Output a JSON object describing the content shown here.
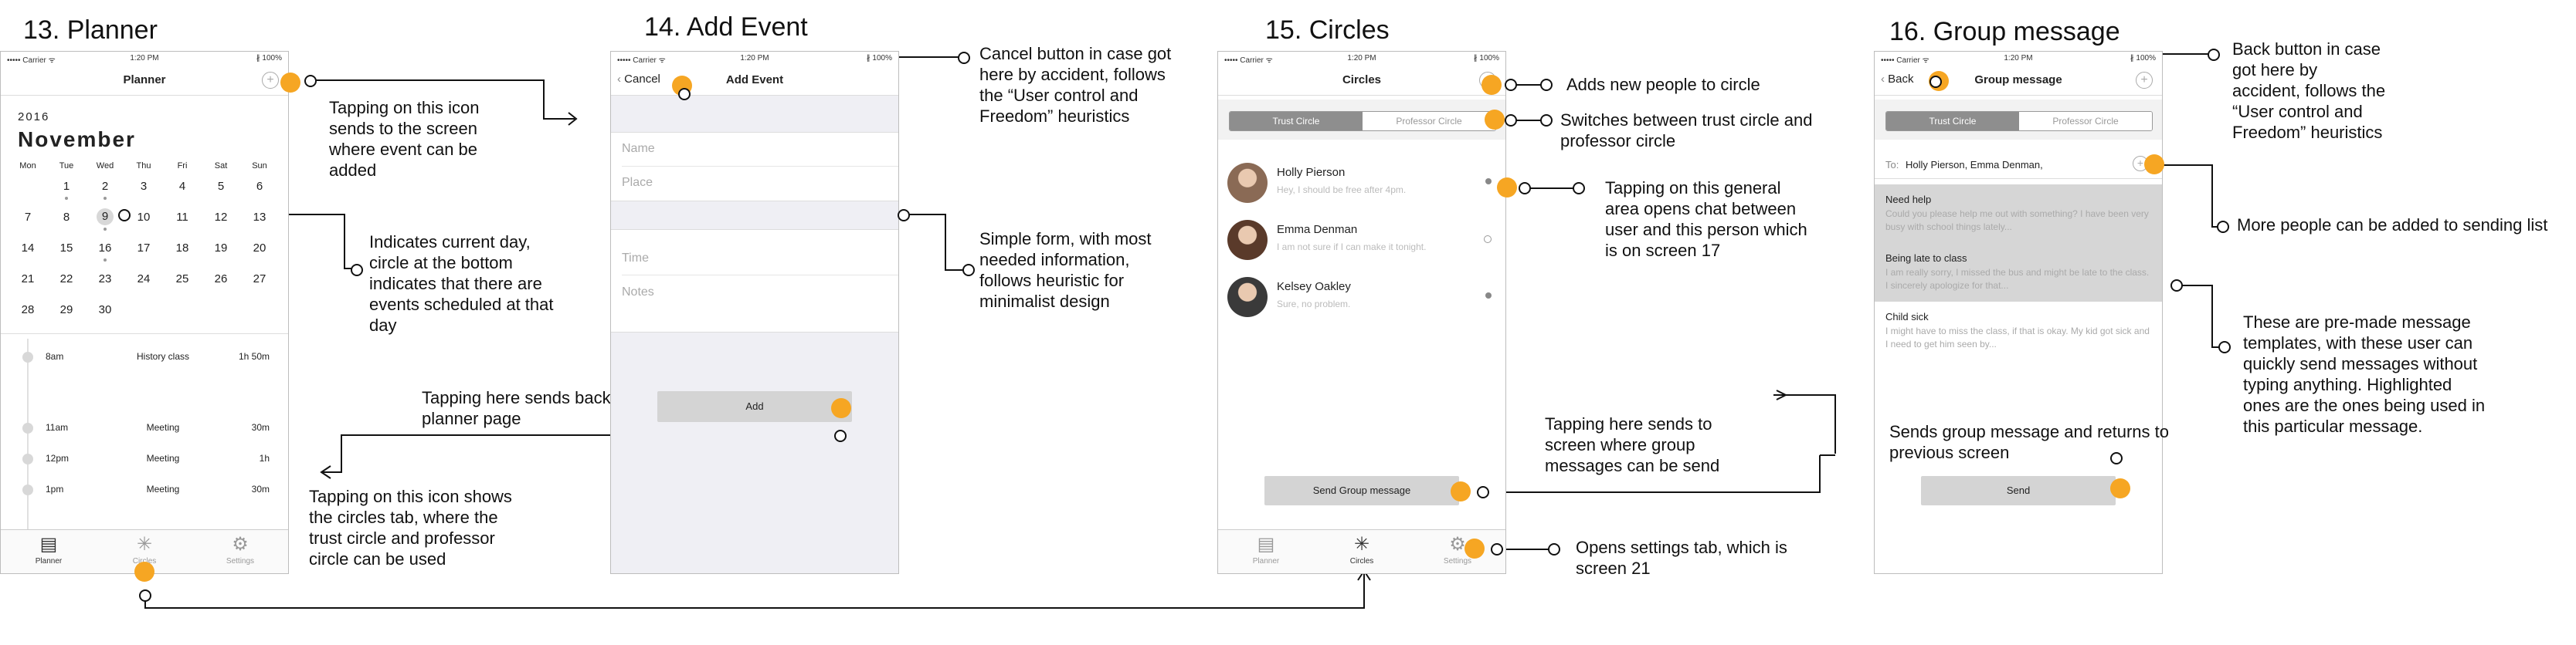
{
  "titles": {
    "planner": "13. Planner",
    "add_event": "14. Add Event",
    "circles": "15. Circles",
    "group_message": "16. Group message"
  },
  "status_bar": {
    "carrier": "••••• Carrier ᯤ",
    "time": "1:20 PM",
    "battery": "∦ 100%"
  },
  "planner": {
    "nav_title": "Planner",
    "year": "2016",
    "month": "November",
    "weekdays": [
      "Mon",
      "Tue",
      "Wed",
      "Thu",
      "Fri",
      "Sat",
      "Sun"
    ],
    "days": [
      "1",
      "2",
      "3",
      "4",
      "5",
      "6",
      "7",
      "8",
      "9",
      "10",
      "11",
      "12",
      "13",
      "14",
      "15",
      "16",
      "17",
      "18",
      "19",
      "20",
      "21",
      "22",
      "23",
      "24",
      "25",
      "26",
      "27",
      "28",
      "29",
      "30"
    ],
    "events": [
      {
        "time": "8am",
        "name": "History class",
        "duration": "1h 50m"
      },
      {
        "time": "11am",
        "name": "Meeting",
        "duration": "30m"
      },
      {
        "time": "12pm",
        "name": "Meeting",
        "duration": "1h"
      },
      {
        "time": "1pm",
        "name": "Meeting",
        "duration": "30m"
      }
    ]
  },
  "tabs": {
    "planner": "Planner",
    "circles": "Circles",
    "settings": "Settings"
  },
  "icons": {
    "plus": "plus-icon",
    "back": "chevron-left-icon",
    "planner": "calendar-icon",
    "circles": "network-icon",
    "settings": "gear-icon"
  },
  "add_event": {
    "cancel": "Cancel",
    "nav_title": "Add Event",
    "name": "Name",
    "place": "Place",
    "time": "Time",
    "notes": "Notes",
    "add": "Add"
  },
  "circles": {
    "nav_title": "Circles",
    "seg_trust": "Trust Circle",
    "seg_professor": "Professor Circle",
    "contacts": [
      {
        "name": "Holly Pierson",
        "message": "Hey, I should be free after 4pm."
      },
      {
        "name": "Emma Denman",
        "message": "I am not sure if I can make it tonight."
      },
      {
        "name": "Kelsey Oakley",
        "message": "Sure, no problem."
      }
    ],
    "send_group": "Send Group message"
  },
  "group_message": {
    "back": "Back",
    "nav_title": "Group message",
    "seg_trust": "Trust Circle",
    "seg_professor": "Professor Circle",
    "to_label": "To:",
    "to_value": "Holly Pierson, Emma Denman,",
    "templates": [
      {
        "title": "Need help",
        "body": "Could you please help me out with something? I have been very busy with school things lately..."
      },
      {
        "title": "Being late to class",
        "body": "I am really sorry, I missed the bus and might be late to the class. I sincerely apologize for that..."
      },
      {
        "title": "Child sick",
        "body": "I might have to miss the class, if that is okay. My kid got sick and I need to get him seen by..."
      }
    ],
    "send": "Send"
  },
  "annotations": {
    "a1": "Tapping on this icon sends to the screen where event can be added",
    "a2": "Indicates current day, circle at the bottom indicates that there are events scheduled at that day",
    "a3": "Tapping here sends back to planner page",
    "a4": "Tapping on this icon shows the circles tab, where the trust circle and professor circle can be used",
    "a5": "Cancel button in case got here by accident, follows the “User control and Freedom” heuristics",
    "a6": "Simple form, with most needed information, follows heuristic for minimalist design",
    "a7": "Adds new people to circle",
    "a8": "Switches between trust circle and professor circle",
    "a9": "Tapping on this general area opens chat between user and this person which is on screen 17",
    "a10": "Tapping here sends to screen where group messages can be send",
    "a11": "Opens settings tab, which is screen 21",
    "a12": "Back button in case got here by accident, follows the “User control and Freedom” heuristics",
    "a13": "More people can be added to sending list",
    "a14": "These are pre-made message templates, with these user can quickly send messages without typing anything. Highlighted ones are the ones being used in this particular message.",
    "a15": "Sends group message and returns to previous screen"
  },
  "colors": {
    "accent": "#f6a623",
    "segment_on": "#8e8e8e",
    "template_highlight": "#d6d6d6"
  }
}
